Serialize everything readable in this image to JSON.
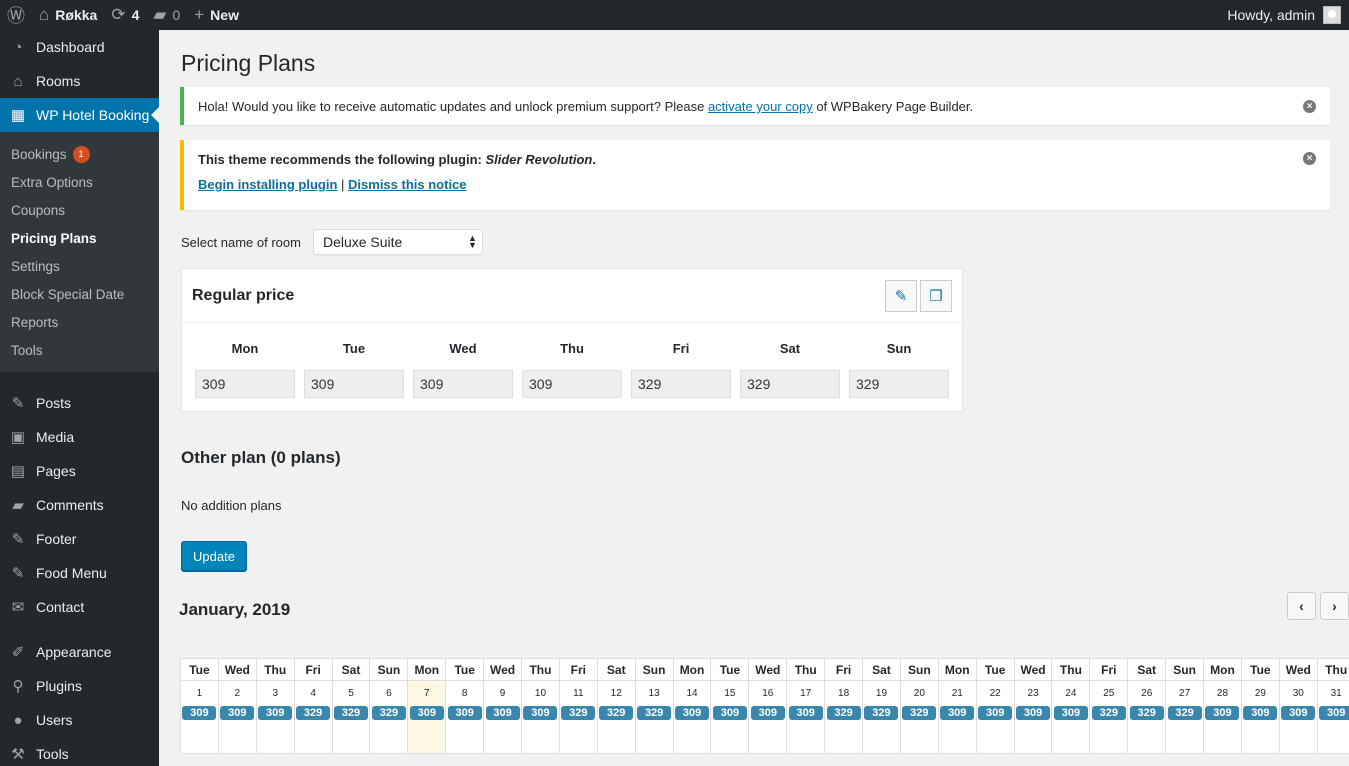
{
  "adminbar": {
    "site_name": "Røkka",
    "updates_count": "4",
    "comments_count": "0",
    "new_label": "New",
    "greeting": "Howdy, admin"
  },
  "sidebar": {
    "top_items": [
      {
        "label": "Dashboard",
        "icon": "dashboard-icon"
      },
      {
        "label": "Rooms",
        "icon": "home-icon"
      },
      {
        "label": "WP Hotel Booking",
        "icon": "calendar-icon",
        "current": true
      }
    ],
    "submenu": [
      {
        "label": "Bookings",
        "badge": "1"
      },
      {
        "label": "Extra Options"
      },
      {
        "label": "Coupons"
      },
      {
        "label": "Pricing Plans",
        "active": true
      },
      {
        "label": "Settings"
      },
      {
        "label": "Block Special Date"
      },
      {
        "label": "Reports"
      },
      {
        "label": "Tools"
      }
    ],
    "bottom_items": [
      {
        "label": "Posts",
        "icon": "pin-icon"
      },
      {
        "label": "Media",
        "icon": "media-icon"
      },
      {
        "label": "Pages",
        "icon": "pages-icon"
      },
      {
        "label": "Comments",
        "icon": "comment-icon"
      },
      {
        "label": "Footer",
        "icon": "pin-icon"
      },
      {
        "label": "Food Menu",
        "icon": "pin-icon"
      },
      {
        "label": "Contact",
        "icon": "mail-icon"
      }
    ],
    "bottom_items2": [
      {
        "label": "Appearance",
        "icon": "brush-icon"
      },
      {
        "label": "Plugins",
        "icon": "plugin-icon"
      },
      {
        "label": "Users",
        "icon": "user-icon"
      },
      {
        "label": "Tools",
        "icon": "wrench-icon"
      }
    ]
  },
  "page": {
    "title": "Pricing Plans",
    "notice1": {
      "text_before": "Hola! Would you like to receive automatic updates and unlock premium support? Please ",
      "link": "activate your copy",
      "text_after": " of WPBakery Page Builder."
    },
    "notice2": {
      "text_before": "This theme recommends the following plugin: ",
      "plugin": "Slider Revolution",
      "text_after": ".",
      "install_link": "Begin installing plugin",
      "separator": "|",
      "dismiss_link": "Dismiss this notice"
    },
    "room_select_label": "Select name of room",
    "room_selected": "Deluxe Suite",
    "regular_price": {
      "title": "Regular price",
      "days": [
        {
          "day": "Mon",
          "price": "309"
        },
        {
          "day": "Tue",
          "price": "309"
        },
        {
          "day": "Wed",
          "price": "309"
        },
        {
          "day": "Thu",
          "price": "309"
        },
        {
          "day": "Fri",
          "price": "329"
        },
        {
          "day": "Sat",
          "price": "329"
        },
        {
          "day": "Sun",
          "price": "329"
        }
      ]
    },
    "other_plan_title": "Other plan (0 plans)",
    "no_plans_text": "No addition plans",
    "update_label": "Update",
    "month_title": "January, 2019",
    "calendar": [
      {
        "d": "Tue",
        "n": "1",
        "p": "309"
      },
      {
        "d": "Wed",
        "n": "2",
        "p": "309"
      },
      {
        "d": "Thu",
        "n": "3",
        "p": "309"
      },
      {
        "d": "Fri",
        "n": "4",
        "p": "329"
      },
      {
        "d": "Sat",
        "n": "5",
        "p": "329"
      },
      {
        "d": "Sun",
        "n": "6",
        "p": "329"
      },
      {
        "d": "Mon",
        "n": "7",
        "p": "309",
        "today": true
      },
      {
        "d": "Tue",
        "n": "8",
        "p": "309"
      },
      {
        "d": "Wed",
        "n": "9",
        "p": "309"
      },
      {
        "d": "Thu",
        "n": "10",
        "p": "309"
      },
      {
        "d": "Fri",
        "n": "11",
        "p": "329"
      },
      {
        "d": "Sat",
        "n": "12",
        "p": "329"
      },
      {
        "d": "Sun",
        "n": "13",
        "p": "329"
      },
      {
        "d": "Mon",
        "n": "14",
        "p": "309"
      },
      {
        "d": "Tue",
        "n": "15",
        "p": "309"
      },
      {
        "d": "Wed",
        "n": "16",
        "p": "309"
      },
      {
        "d": "Thu",
        "n": "17",
        "p": "309"
      },
      {
        "d": "Fri",
        "n": "18",
        "p": "329"
      },
      {
        "d": "Sat",
        "n": "19",
        "p": "329"
      },
      {
        "d": "Sun",
        "n": "20",
        "p": "329"
      },
      {
        "d": "Mon",
        "n": "21",
        "p": "309"
      },
      {
        "d": "Tue",
        "n": "22",
        "p": "309"
      },
      {
        "d": "Wed",
        "n": "23",
        "p": "309"
      },
      {
        "d": "Thu",
        "n": "24",
        "p": "309"
      },
      {
        "d": "Fri",
        "n": "25",
        "p": "329"
      },
      {
        "d": "Sat",
        "n": "26",
        "p": "329"
      },
      {
        "d": "Sun",
        "n": "27",
        "p": "329"
      },
      {
        "d": "Mon",
        "n": "28",
        "p": "309"
      },
      {
        "d": "Tue",
        "n": "29",
        "p": "309"
      },
      {
        "d": "Wed",
        "n": "30",
        "p": "309"
      },
      {
        "d": "Thu",
        "n": "31",
        "p": "309"
      }
    ]
  },
  "colors": {
    "admin_dark": "#23282d",
    "accent": "#0073aa",
    "price_tag": "#3a87ad",
    "notice_success": "#46b450",
    "notice_warning": "#ffb900"
  }
}
